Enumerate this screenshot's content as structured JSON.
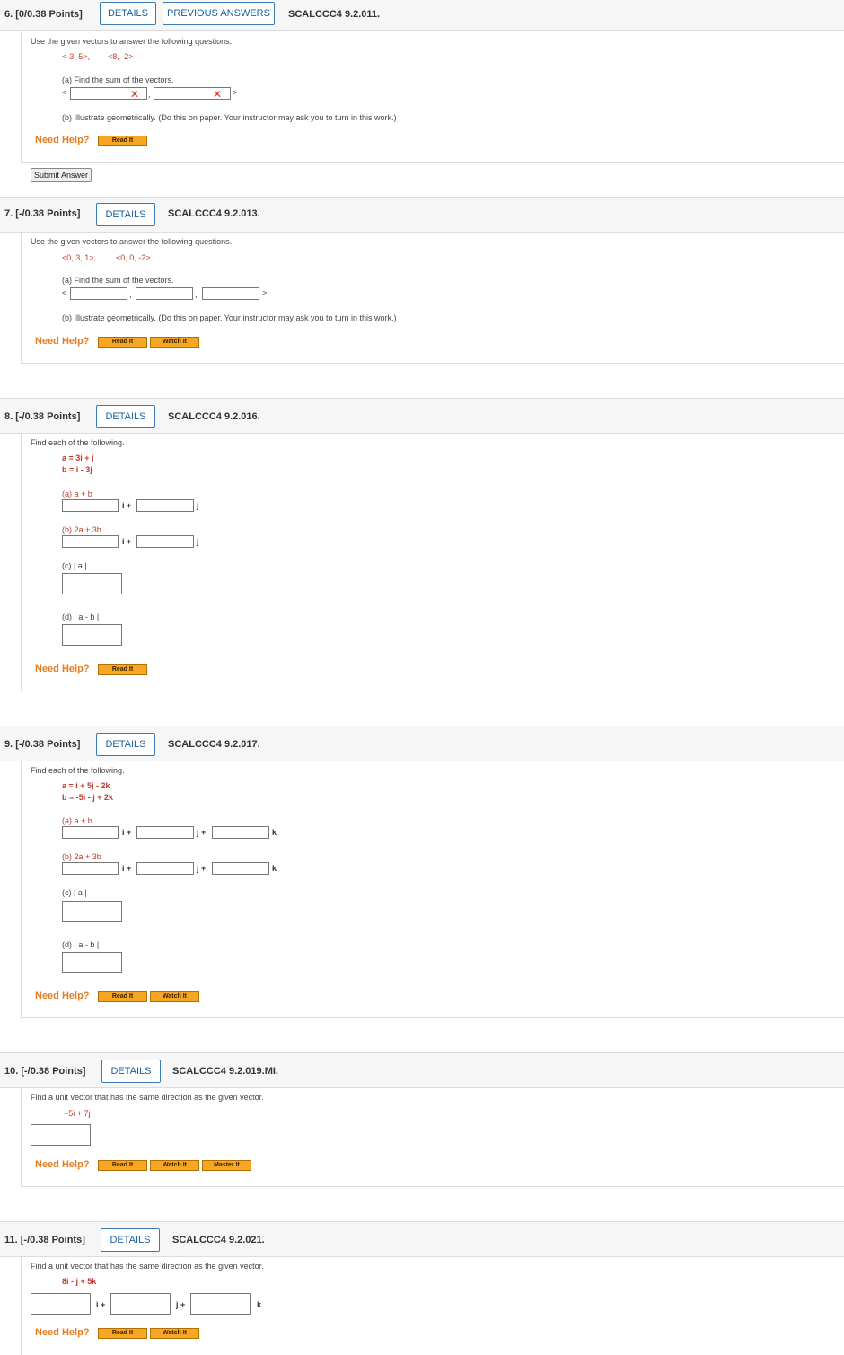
{
  "common": {
    "details": "DETAILS",
    "prev_answers": "PREVIOUS ANSWERS",
    "need_help": "Need Help?",
    "read_it": "Read It",
    "watch_it": "Watch It",
    "master_it": "Master It",
    "submit": "Submit Answer",
    "sum_instr": "Use the given vectors to answer the following questions.",
    "part_a_sum": "(a) Find the sum of the vectors.",
    "part_b_geo": "(b) Illustrate geometrically. (Do this on paper. Your instructor may ask you to turn in this work.)",
    "find_each": "Find each of the following.",
    "unit_instr": "Find a unit vector that has the same direction as the given vector.",
    "lt": "<",
    "gt": ">",
    "comma": ",",
    "i_plus": "i +",
    "j_plus": "j +",
    "j": "j",
    "k": "k",
    "cross_icon": "x-mark-icon",
    "a_plus_b": "(a) a + b",
    "two_a_plus_3b": "(b) 2a + 3b",
    "abs_a": "(c) | a |",
    "abs_a_minus_b": "(d) | a - b |"
  },
  "q6": {
    "points": "6. [0/0.38 Points]",
    "code": "SCALCCC4 9.2.011.",
    "v1": "<-3, 5>,",
    "v2": "<8, -2>"
  },
  "q7": {
    "points": "7. [-/0.38 Points]",
    "code": "SCALCCC4 9.2.013.",
    "v1": "<0, 3, 1>,",
    "v2": "<0, 0, -2>"
  },
  "q8": {
    "points": "8. [-/0.38 Points]",
    "code": "SCALCCC4 9.2.016.",
    "a": "a = 3i + j",
    "b": "b = i - 3j"
  },
  "q9": {
    "points": "9. [-/0.38 Points]",
    "code": "SCALCCC4 9.2.017.",
    "a": "a = i + 5j - 2k",
    "b": "b = -5i - j + 2k"
  },
  "q10": {
    "points": "10. [-/0.38 Points]",
    "code": "SCALCCC4 9.2.019.MI.",
    "v": "−5i + 7j"
  },
  "q11": {
    "points": "11. [-/0.38 Points]",
    "code": "SCALCCC4 9.2.021.",
    "v": "8i - j + 5k"
  }
}
